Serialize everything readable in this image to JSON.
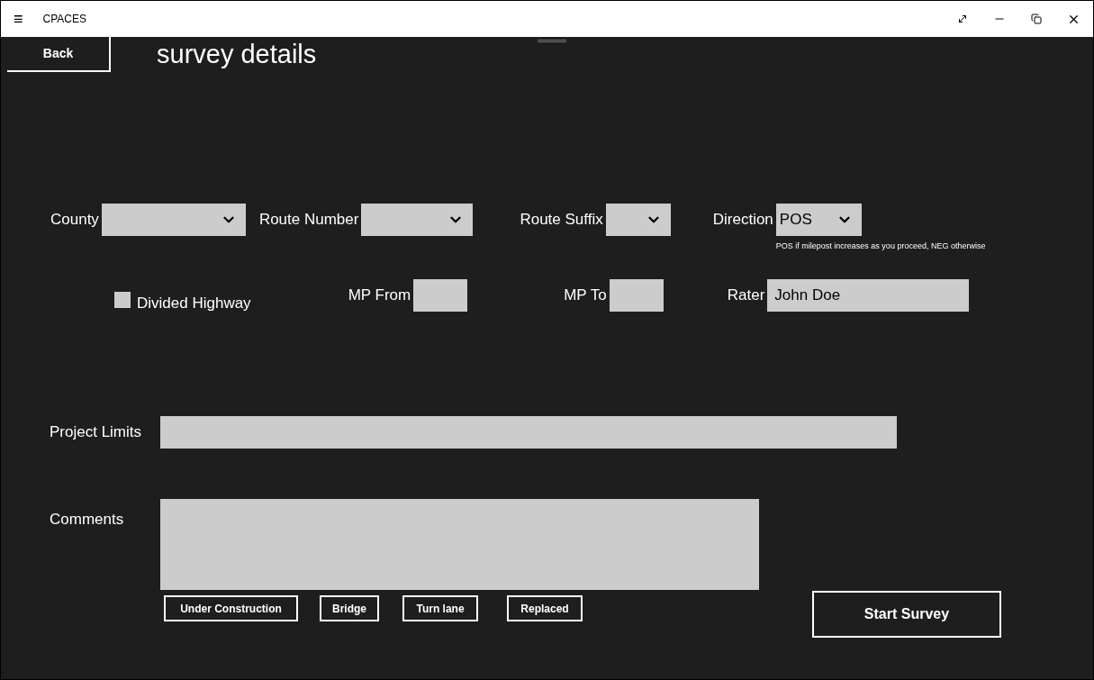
{
  "window": {
    "title": "CPACES",
    "menu_icon": "≡"
  },
  "back_button": "Back",
  "heading": "survey details",
  "row1": [
    {
      "label": "County",
      "kind": "dropdown"
    },
    {
      "label": "Route Number",
      "kind": "dropdown"
    },
    {
      "label": "Route Suffix",
      "kind": "dropdown"
    },
    {
      "label": "Direction",
      "kind": "dropdown",
      "value": "POS",
      "hint": "POS if milepost increases as you proceed, NEG otherwise"
    }
  ],
  "divided_highway": {
    "label": "Divided Highway",
    "checked": false
  },
  "row2": [
    {
      "label": "MP From"
    },
    {
      "label": "MP To"
    },
    {
      "label": "Rater",
      "value": "John Doe"
    }
  ],
  "project_limits": {
    "label": "Project Limits"
  },
  "comments": {
    "label": "Comments"
  },
  "comment_buttons": [
    "Under Construction",
    "Bridge",
    "Turn lane",
    "Replaced"
  ],
  "start_button": "Start Survey"
}
